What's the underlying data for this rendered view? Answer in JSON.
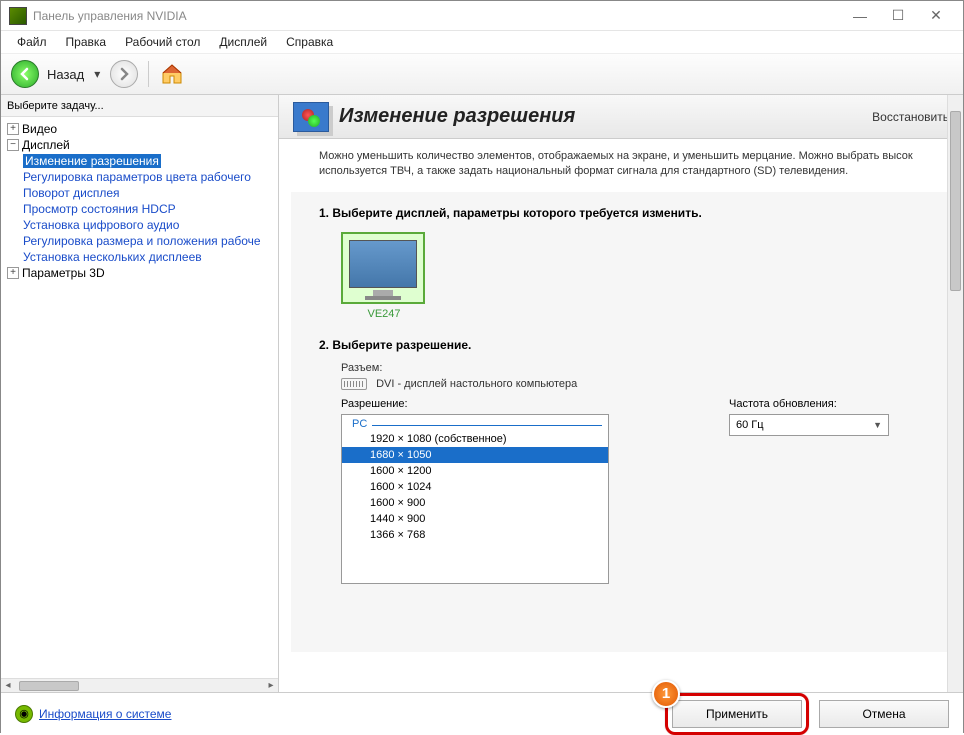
{
  "window": {
    "title": "Панель управления NVIDIA"
  },
  "menu": {
    "file": "Файл",
    "edit": "Правка",
    "desktop": "Рабочий стол",
    "display": "Дисплей",
    "help": "Справка"
  },
  "toolbar": {
    "back": "Назад"
  },
  "sidebar": {
    "header": "Выберите задачу...",
    "items": [
      {
        "label": "Видео",
        "level": 1,
        "pm": "+"
      },
      {
        "label": "Дисплей",
        "level": 1,
        "pm": "−"
      },
      {
        "label": "Изменение разрешения",
        "level": 2,
        "selected": true,
        "link": true
      },
      {
        "label": "Регулировка параметров цвета рабочего",
        "level": 2,
        "link": true
      },
      {
        "label": "Поворот дисплея",
        "level": 2,
        "link": true
      },
      {
        "label": "Просмотр состояния HDCP",
        "level": 2,
        "link": true
      },
      {
        "label": "Установка цифрового аудио",
        "level": 2,
        "link": true
      },
      {
        "label": "Регулировка размера и положения рабоче",
        "level": 2,
        "link": true
      },
      {
        "label": "Установка нескольких дисплеев",
        "level": 2,
        "link": true
      },
      {
        "label": "Параметры 3D",
        "level": 1,
        "pm": "+"
      }
    ]
  },
  "header": {
    "title": "Изменение разрешения",
    "restore": "Восстановить"
  },
  "desc": "Можно уменьшить количество элементов, отображаемых на экране, и уменьшить мерцание. Можно выбрать высок используется ТВЧ, а также задать национальный формат сигнала для стандартного (SD) телевидения.",
  "section1": {
    "title": "1. Выберите дисплей, параметры которого требуется изменить.",
    "monitor_label": "VE247"
  },
  "section2": {
    "title": "2. Выберите разрешение.",
    "connector_label": "Разъем:",
    "connector_value": "DVI - дисплей настольного компьютера",
    "resolution_label": "Разрешение:",
    "refresh_label": "Частота обновления:",
    "refresh_value": "60 Гц",
    "group_label": "PC",
    "resolutions": [
      {
        "label": "1920 × 1080 (собственное)"
      },
      {
        "label": "1680 × 1050",
        "selected": true
      },
      {
        "label": "1600 × 1200"
      },
      {
        "label": "1600 × 1024"
      },
      {
        "label": "1600 × 900"
      },
      {
        "label": "1440 × 900"
      },
      {
        "label": "1366 × 768"
      }
    ]
  },
  "footer": {
    "sysinfo": "Информация о системе",
    "apply": "Применить",
    "cancel": "Отмена",
    "callout": "1"
  }
}
